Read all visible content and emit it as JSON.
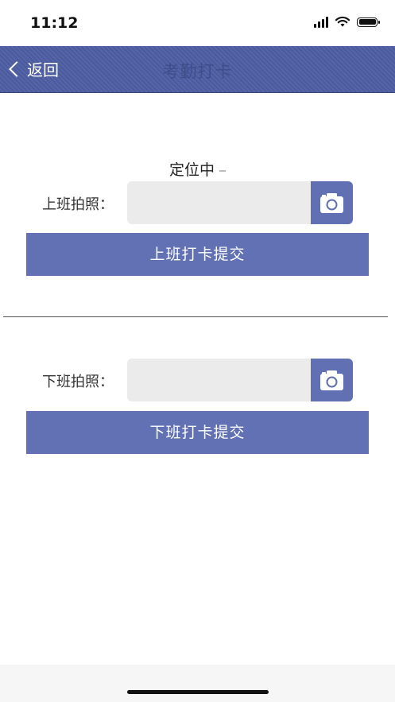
{
  "status_bar": {
    "time": "11:12"
  },
  "nav": {
    "back_label": "返回",
    "title": "考勤打卡"
  },
  "location": {
    "status_text": "定位中"
  },
  "clock_in": {
    "photo_label": "上班拍照：",
    "submit_label": "上班打卡提交"
  },
  "clock_out": {
    "photo_label": "下班拍照：",
    "submit_label": "下班打卡提交"
  },
  "colors": {
    "nav_bar": "#4f5fa3",
    "accent": "#6171b3",
    "field_bg": "#ebebeb"
  },
  "icons": {
    "back": "chevron-left-icon",
    "camera": "camera-icon"
  }
}
